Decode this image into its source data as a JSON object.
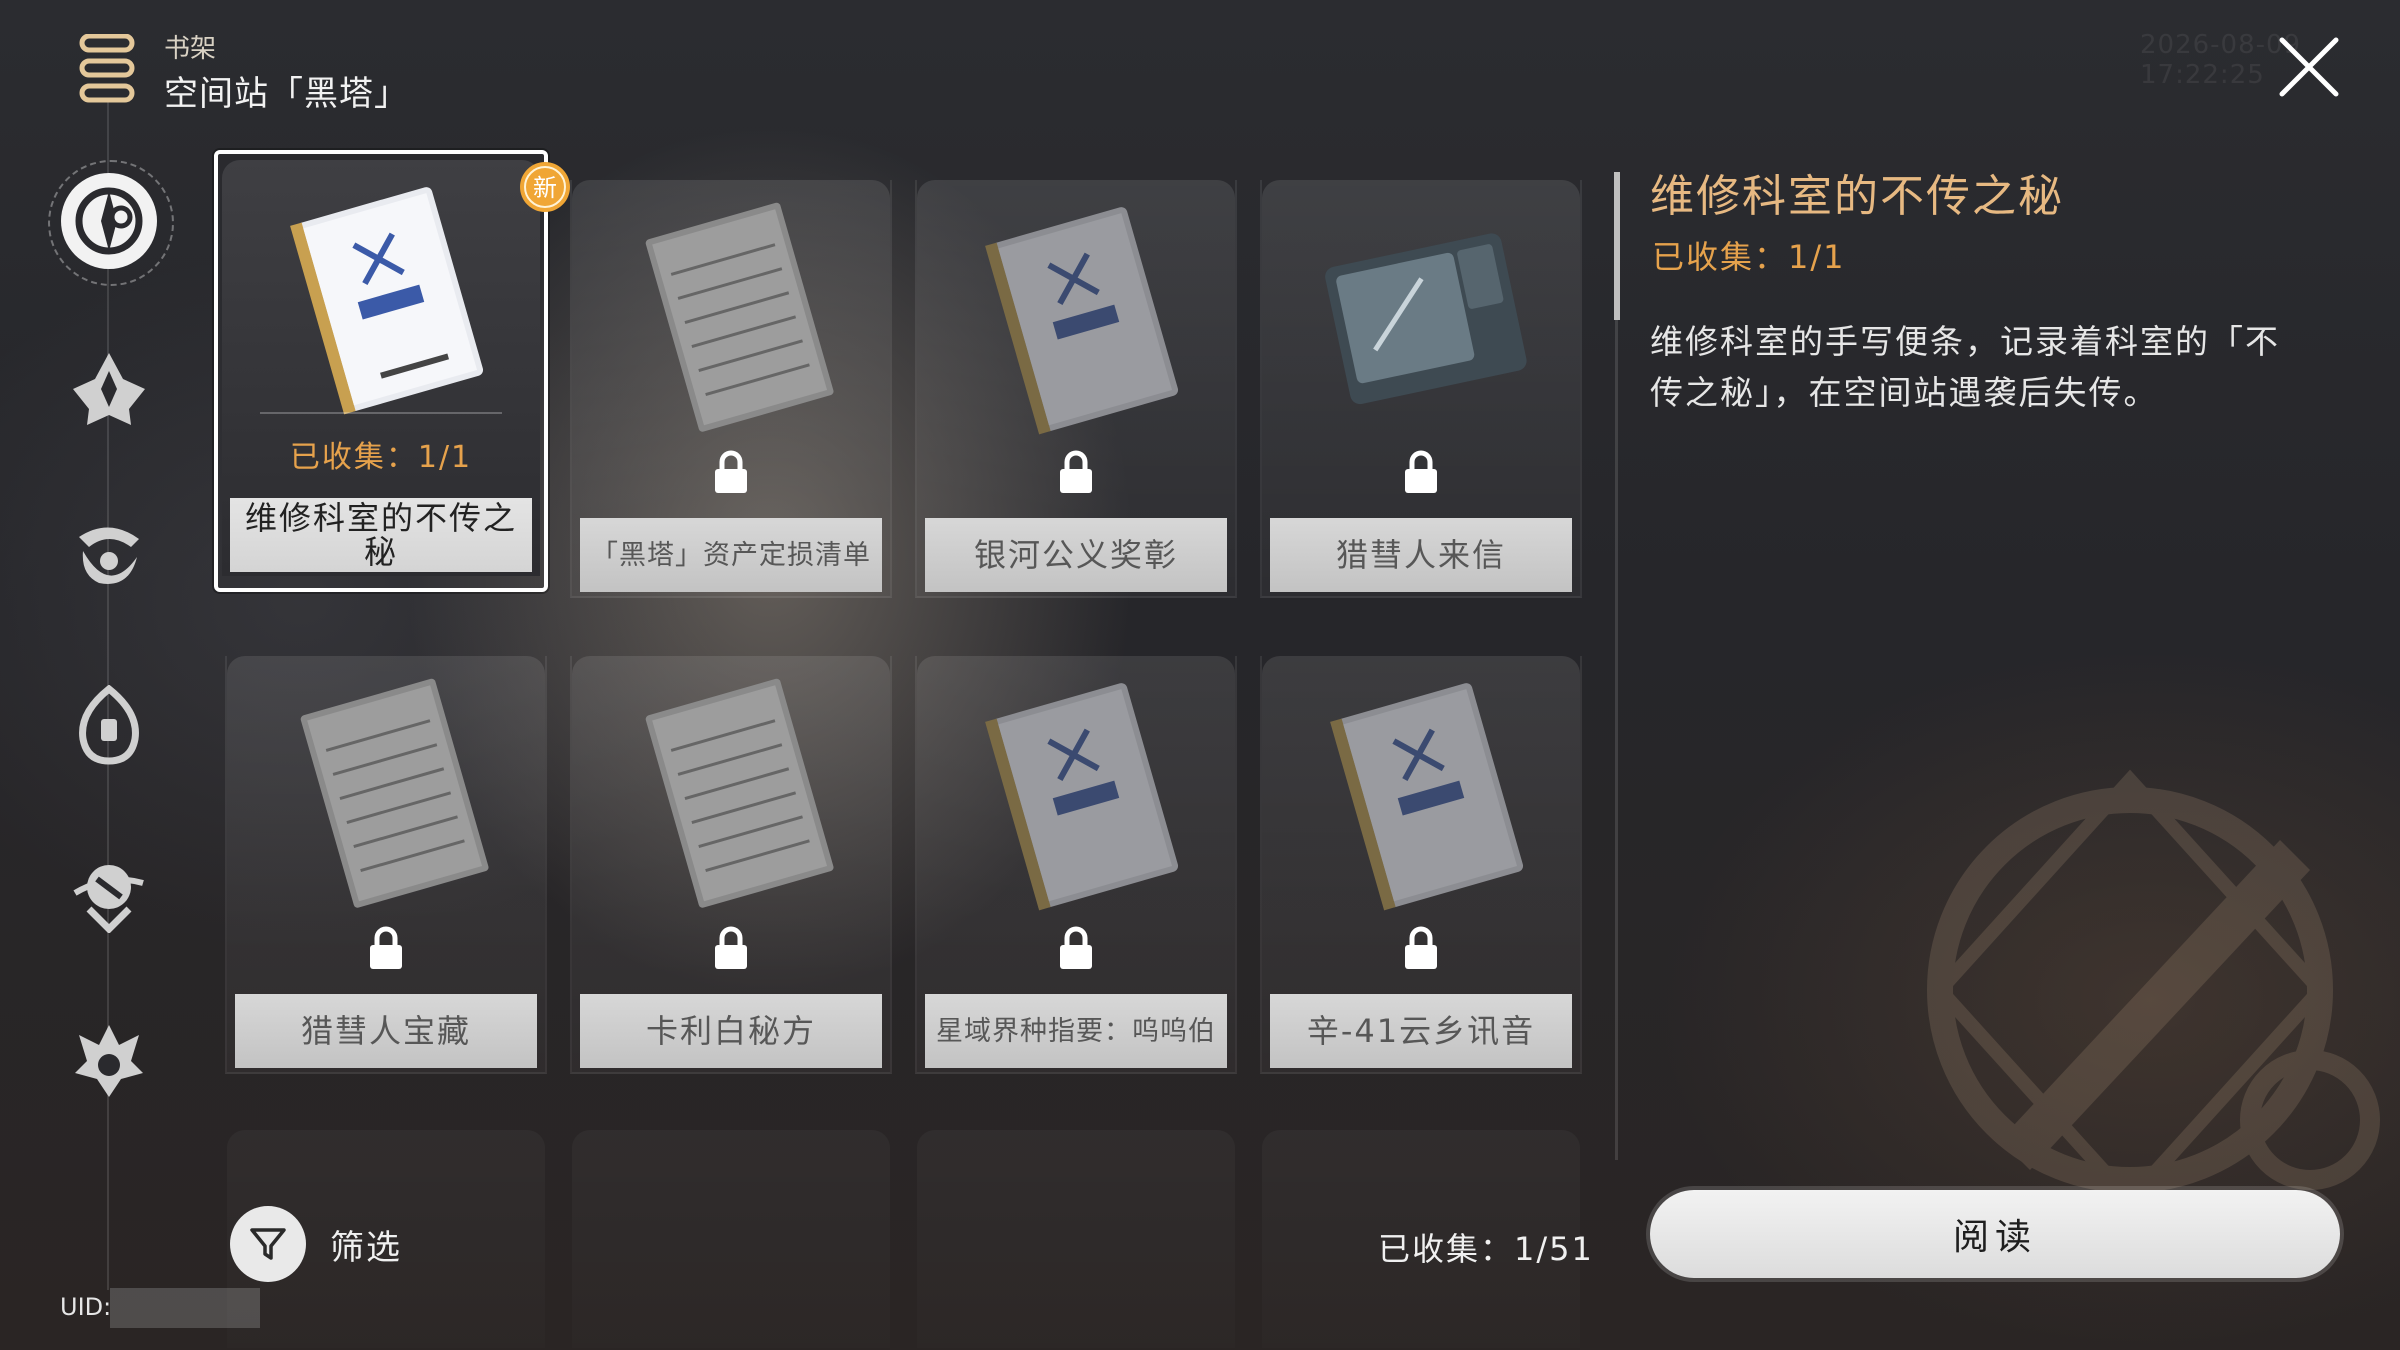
{
  "header": {
    "subtitle": "书架",
    "title": "空间站「黑塔」"
  },
  "timestamp": "2026-08-09 17:22:25",
  "sidebar": {
    "paths": [
      {
        "name": "space-station-icon",
        "active": true
      },
      {
        "name": "jarilo-icon",
        "active": false
      },
      {
        "name": "xianzhou-icon",
        "active": false
      },
      {
        "name": "penacony-icon",
        "active": false
      },
      {
        "name": "planet-icon",
        "active": false
      },
      {
        "name": "flame-icon",
        "active": false
      }
    ],
    "uid_label": "UID:"
  },
  "books": [
    {
      "title": "维修科室的不传之秘",
      "type": "manual",
      "selected": true,
      "unlocked": true,
      "is_new": true,
      "new_badge": "新",
      "collected": "已收集：1/1"
    },
    {
      "title": "「黑塔」资产定损清单",
      "type": "note",
      "selected": false,
      "unlocked": false
    },
    {
      "title": "银河公义奖彰",
      "type": "manual",
      "selected": false,
      "unlocked": false
    },
    {
      "title": "猎彗人来信",
      "type": "tablet",
      "selected": false,
      "unlocked": false
    },
    {
      "title": "猎彗人宝藏",
      "type": "note",
      "selected": false,
      "unlocked": false
    },
    {
      "title": "卡利白秘方",
      "type": "note",
      "selected": false,
      "unlocked": false
    },
    {
      "title": "星域界种指要：呜呜伯",
      "type": "manual",
      "selected": false,
      "unlocked": false
    },
    {
      "title": "辛-41云乡讯音",
      "type": "manual",
      "selected": false,
      "unlocked": false
    }
  ],
  "detail": {
    "title": "维修科室的不传之秘",
    "collected": "已收集：1/1",
    "description": "维修科室的手写便条，记录着科室的「不传之秘」，在空间站遇袭后失传。"
  },
  "footer": {
    "filter_label": "筛选",
    "total_collected": "已收集：1/51",
    "read_button": "阅读"
  },
  "colors": {
    "accent_gold": "#e6a24c",
    "title_gold": "#e7b982",
    "badge_orange": "#f0a635"
  }
}
